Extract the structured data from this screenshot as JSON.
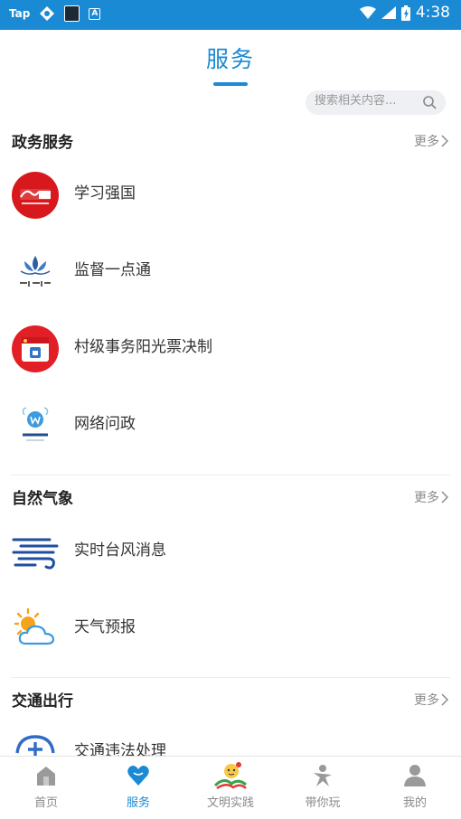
{
  "status_bar": {
    "app_badge": "Tap",
    "time": "4:38"
  },
  "header": {
    "title": "服务"
  },
  "search": {
    "placeholder": "搜索相关内容..."
  },
  "sections": [
    {
      "title": "政务服务",
      "more": "更多",
      "items": [
        {
          "label": "学习强国",
          "icon": "xuexi-qiangguo-logo"
        },
        {
          "label": "监督一点通",
          "icon": "qinglian-lotus-logo"
        },
        {
          "label": "村级事务阳光票决制",
          "icon": "village-affairs-logo"
        },
        {
          "label": "网络问政",
          "icon": "wangluo-wenzheng-logo"
        }
      ]
    },
    {
      "title": "自然气象",
      "more": "更多",
      "items": [
        {
          "label": "实时台风消息",
          "icon": "typhoon-wind-icon"
        },
        {
          "label": "天气预报",
          "icon": "weather-sun-cloud-icon"
        }
      ]
    },
    {
      "title": "交通出行",
      "more": "更多",
      "items": [
        {
          "label": "交通违法处理",
          "icon": "traffic-violation-icon"
        }
      ]
    }
  ],
  "tabs": [
    {
      "label": "首页",
      "icon": "home-icon",
      "active": false
    },
    {
      "label": "服务",
      "icon": "heart-icon",
      "active": true
    },
    {
      "label": "文明实践",
      "icon": "civilization-mascot-icon",
      "active": false
    },
    {
      "label": "带你玩",
      "icon": "play-figure-icon",
      "active": false
    },
    {
      "label": "我的",
      "icon": "profile-icon",
      "active": false
    }
  ],
  "colors": {
    "accent": "#1a8ad4",
    "status_bar": "#1a8ad4",
    "inactive_tab": "#8a8a8a"
  }
}
